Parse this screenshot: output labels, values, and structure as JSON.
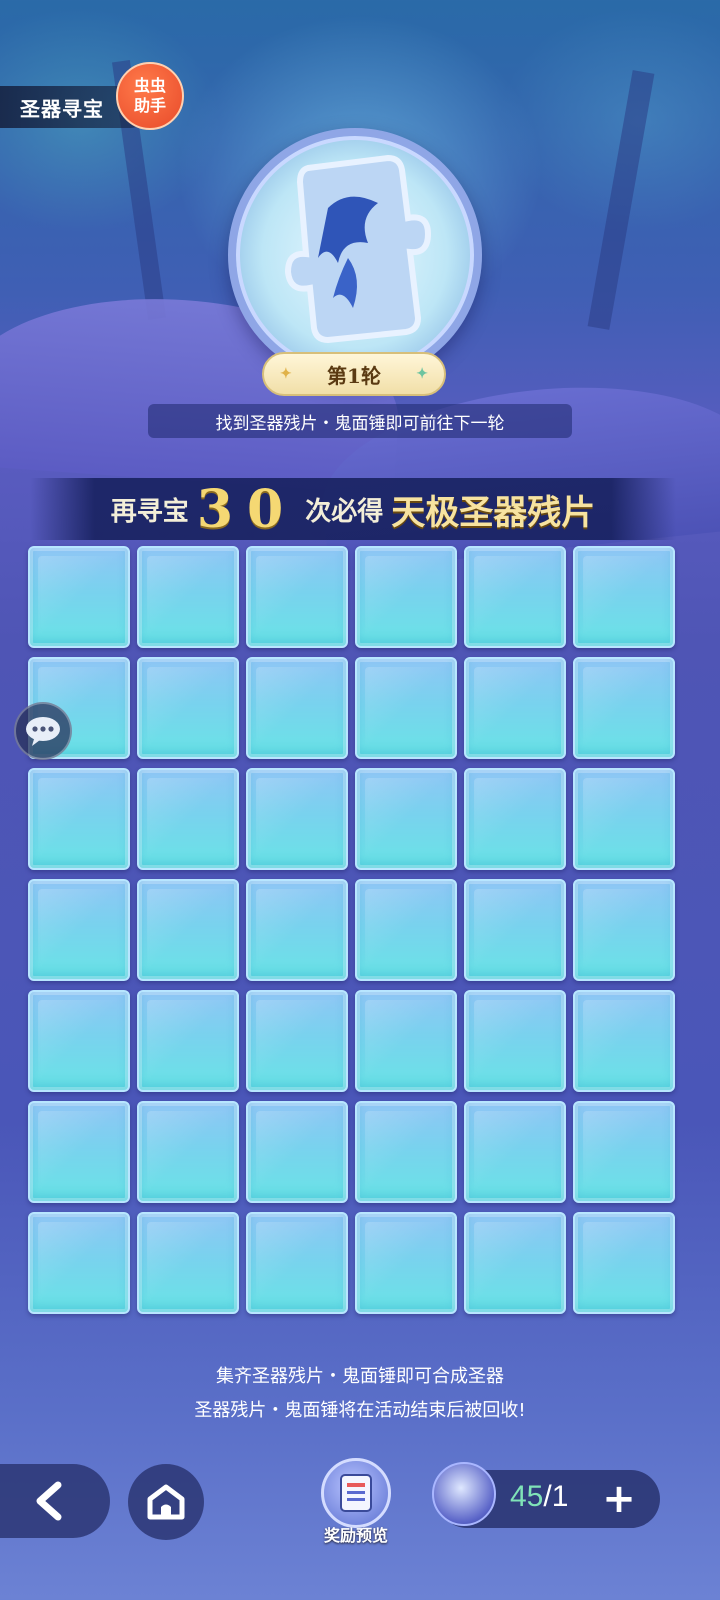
{
  "header": {
    "title": "圣器寻宝",
    "helper_badge_line1": "虫虫",
    "helper_badge_line2": "助手"
  },
  "round": {
    "label": "第1轮",
    "hint": "找到圣器残片・鬼面锤即可前往下一轮"
  },
  "guarantee": {
    "prefix": "再寻宝",
    "count": "30",
    "middle": "次必得",
    "reward": "天极圣器残片"
  },
  "grid": {
    "rows": 7,
    "columns": 6
  },
  "notes": {
    "line1": "集齐圣器残片・鬼面锤即可合成圣器",
    "line2": "圣器残片・鬼面锤将在活动结束后被回收!"
  },
  "bottom_bar": {
    "reward_preview_label": "奖励预览",
    "currency_owned": "45",
    "currency_separator": "/",
    "currency_cost": "1",
    "plus_label": "+",
    "back_icon": "chevron-left-icon",
    "home_icon": "home-icon"
  },
  "colors": {
    "tile_top": "#8fc6f5",
    "tile_bottom": "#69e4e6",
    "accent_gold": "#f5d873",
    "counter_green": "#7fe3b8"
  }
}
